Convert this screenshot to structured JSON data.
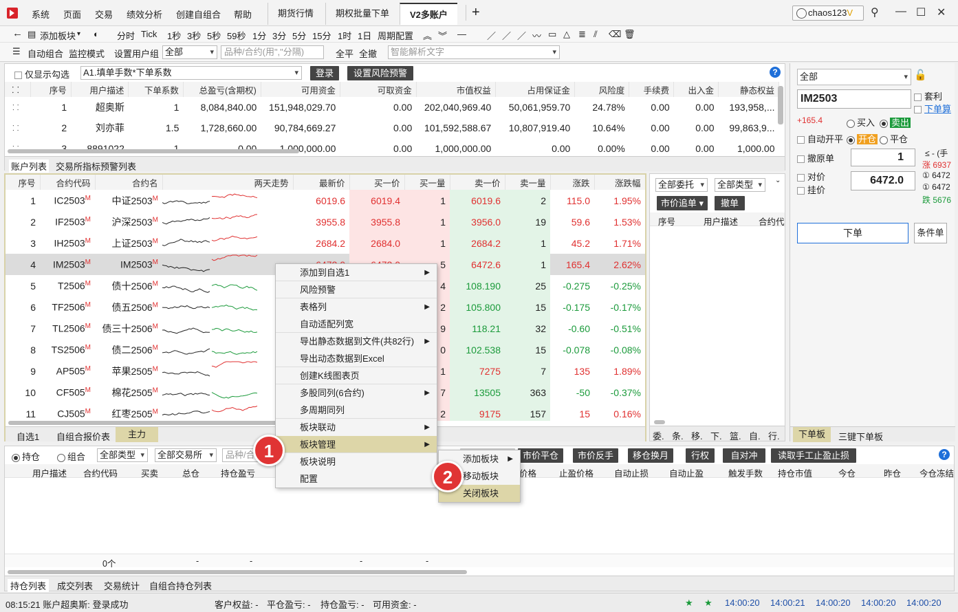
{
  "menu": {
    "items": [
      "系统",
      "页面",
      "交易",
      "绩效分析",
      "创建自组合",
      "帮助"
    ]
  },
  "tabs": [
    "期货行情",
    "期权批量下单",
    "V2多账户"
  ],
  "user": "chaos123",
  "user_badge": "V",
  "toolbar1": {
    "back": "←",
    "add_board": "添加板块",
    "periods": [
      "分时",
      "Tick",
      "1秒",
      "3秒",
      "5秒",
      "59秒",
      "1分",
      "3分",
      "5分",
      "15分",
      "1时",
      "1日",
      "周期配置"
    ]
  },
  "toolbar2": {
    "auto_combo": "自动组合",
    "monitor_mode": "监控模式",
    "set_group": "设置用户组",
    "group_value": "全部",
    "code_placeholder": "品种/合约(用\",\"分隔)",
    "close_all": "全平",
    "cancel_all": "全撤",
    "smart_placeholder": "智能解析文字"
  },
  "account_panel": {
    "only_checked": "仅显示勾选",
    "formula": "A1.填单手数*下单系数",
    "login": "登录",
    "risk_alert": "设置风险预警",
    "headers": [
      "序号",
      "用户描述",
      "下单系数",
      "总盈亏(含期权)",
      "可用资金",
      "可取资金",
      "市值权益",
      "占用保证金",
      "风险度",
      "手续费",
      "出入金",
      "静态权益"
    ],
    "rows": [
      [
        "1",
        "超奥斯",
        "1",
        "8,084,840.00",
        "151,948,029.70",
        "0.00",
        "202,040,969.40",
        "50,061,959.70",
        "24.78%",
        "0.00",
        "0.00",
        "193,958,..."
      ],
      [
        "2",
        "刘亦菲",
        "1.5",
        "1,728,660.00",
        "90,784,669.27",
        "0.00",
        "101,592,588.67",
        "10,807,919.40",
        "10.64%",
        "0.00",
        "0.00",
        "99,863,9..."
      ],
      [
        "3",
        "8891022",
        "1",
        "0.00",
        "1,000,000.00",
        "0.00",
        "1,000,000.00",
        "0.00",
        "0.00%",
        "0.00",
        "0.00",
        "1,000.00"
      ]
    ],
    "tabs": [
      "账户列表",
      "交易所指标预警列表"
    ]
  },
  "quote_panel": {
    "headers": [
      "序号",
      "合约代码",
      "合约名",
      "两天走势",
      "最新价",
      "买一价",
      "买一量",
      "卖一价",
      "卖一量",
      "涨跌",
      "涨跌幅"
    ],
    "rows": [
      {
        "no": "1",
        "code": "IC2503",
        "name": "中证2503",
        "last": "6019.6",
        "bid": "6019.4",
        "bidv": "1",
        "ask": "6019.6",
        "askv": "2",
        "chg": "115.0",
        "pct": "1.95%",
        "dir": "up"
      },
      {
        "no": "2",
        "code": "IF2503",
        "name": "沪深2503",
        "last": "3955.8",
        "bid": "3955.8",
        "bidv": "1",
        "ask": "3956.0",
        "askv": "19",
        "chg": "59.6",
        "pct": "1.53%",
        "dir": "up"
      },
      {
        "no": "3",
        "code": "IH2503",
        "name": "上证2503",
        "last": "2684.2",
        "bid": "2684.0",
        "bidv": "1",
        "ask": "2684.2",
        "askv": "1",
        "chg": "45.2",
        "pct": "1.71%",
        "dir": "up"
      },
      {
        "no": "4",
        "code": "IM2503",
        "name": "IM2503",
        "last": "6472.0",
        "bid": "6472.0",
        "bidv": "5",
        "ask": "6472.6",
        "askv": "1",
        "chg": "165.4",
        "pct": "2.62%",
        "dir": "up"
      },
      {
        "no": "5",
        "code": "T2506",
        "name": "债十2506",
        "last": "",
        "bid": "",
        "bidv": "4",
        "ask": "108.190",
        "askv": "25",
        "chg": "-0.275",
        "pct": "-0.25%",
        "dir": "down"
      },
      {
        "no": "6",
        "code": "TF2506",
        "name": "债五2506",
        "last": "",
        "bid": "",
        "bidv": "2",
        "ask": "105.800",
        "askv": "15",
        "chg": "-0.175",
        "pct": "-0.17%",
        "dir": "down"
      },
      {
        "no": "7",
        "code": "TL2506",
        "name": "债三十2506",
        "last": "",
        "bid": "",
        "bidv": "9",
        "ask": "118.21",
        "askv": "32",
        "chg": "-0.60",
        "pct": "-0.51%",
        "dir": "down"
      },
      {
        "no": "8",
        "code": "TS2506",
        "name": "债二2506",
        "last": "",
        "bid": "",
        "bidv": "0",
        "ask": "102.538",
        "askv": "15",
        "chg": "-0.078",
        "pct": "-0.08%",
        "dir": "down"
      },
      {
        "no": "9",
        "code": "AP505",
        "name": "苹果2505",
        "last": "",
        "bid": "",
        "bidv": "1",
        "ask": "7275",
        "askv": "7",
        "chg": "135",
        "pct": "1.89%",
        "dir": "up"
      },
      {
        "no": "10",
        "code": "CF505",
        "name": "棉花2505",
        "last": "",
        "bid": "",
        "bidv": "7",
        "ask": "13505",
        "askv": "363",
        "chg": "-50",
        "pct": "-0.37%",
        "dir": "down"
      },
      {
        "no": "11",
        "code": "CJ505",
        "name": "红枣2505",
        "last": "",
        "bid": "",
        "bidv": "2",
        "ask": "9175",
        "askv": "157",
        "chg": "15",
        "pct": "0.16%",
        "dir": "up"
      }
    ],
    "tabs": [
      "自选1",
      "自组合报价表",
      "主力"
    ],
    "mark": "M"
  },
  "order_panel": {
    "all_orders": "全部委托",
    "all_types": "全部类型",
    "market_chase": "市价追单",
    "cancel": "撤单",
    "headers": [
      "序号",
      "用户描述",
      "合约代"
    ],
    "tabs": [
      "委.",
      "条.",
      "移.",
      "下.",
      "篮.",
      "自.",
      "行."
    ]
  },
  "trade_panel": {
    "account_sel": "全部",
    "contract": "IM2503",
    "arbitrage": "套利",
    "order_pre": "下单算",
    "change": "+165.4",
    "buy": "买入",
    "sell": "卖出",
    "auto_openclose": "自动开平",
    "open": "开仓",
    "close": "平仓",
    "cancel_orig": "撤原单",
    "qty": "1",
    "qty_note": "≤ - (手",
    "qty_note2": "涨 6937",
    "counter": "对价",
    "limit": "挂价",
    "price": "6472.0",
    "p1": "① 6472",
    "p2": "① 6472",
    "p3": "跌 5676",
    "submit": "下单",
    "cond": "条件单",
    "tabs": [
      "下单板",
      "三键下单板"
    ]
  },
  "position_panel": {
    "hold": "持仓",
    "combo": "组合",
    "all_types": "全部类型",
    "all_exch": "全部交易所",
    "placeholder": "品种/合",
    "buttons": [
      "市价平仓",
      "市价反手",
      "移仓换月",
      "行权",
      "自对冲",
      "读取手工止盈止损"
    ],
    "headers": [
      "用户描述",
      "合约代码",
      "买卖",
      "总仓",
      "持仓盈亏",
      "",
      "",
      "价格",
      "止盈价格",
      "自动止损",
      "自动止盈",
      "触发手数",
      "持仓市值",
      "今仓",
      "昨仓",
      "今仓冻结"
    ],
    "footer": [
      "0个",
      "-",
      "-",
      "-",
      "-"
    ],
    "tabs": [
      "持仓列表",
      "成交列表",
      "交易统计",
      "自组合持仓列表"
    ]
  },
  "context_menu": {
    "items": [
      {
        "label": "添加到自选1",
        "sub": true
      },
      {
        "label": "风险预警",
        "sub": false
      },
      {
        "label": "表格列",
        "sub": true
      },
      {
        "label": "自动适配列宽",
        "sub": false
      },
      {
        "label": "导出静态数据到文件(共82行)",
        "sub": true
      },
      {
        "label": "导出动态数据到Excel",
        "sub": false
      },
      {
        "label": "创建K线图表页",
        "sub": false
      },
      {
        "label": "多股同列(6合约)",
        "sub": true
      },
      {
        "label": "多周期同列",
        "sub": false
      },
      {
        "label": "板块联动",
        "sub": true
      },
      {
        "label": "板块管理",
        "sub": true
      },
      {
        "label": "板块说明",
        "sub": false
      },
      {
        "label": "配置",
        "sub": false
      }
    ],
    "submenu": [
      "添加板块",
      "移动板块",
      "关闭板块"
    ],
    "badge1": "1",
    "badge2": "2"
  },
  "status": {
    "msg": "08:15:21 账户超奥斯: 登录成功",
    "equity": "客户权益: -",
    "close_pl": "平仓盈亏: -",
    "hold_pl": "持仓盈亏: -",
    "avail": "可用资金: -",
    "times": [
      "14:00:20",
      "14:00:21",
      "14:00:20",
      "14:00:20",
      "14:00:20"
    ]
  }
}
